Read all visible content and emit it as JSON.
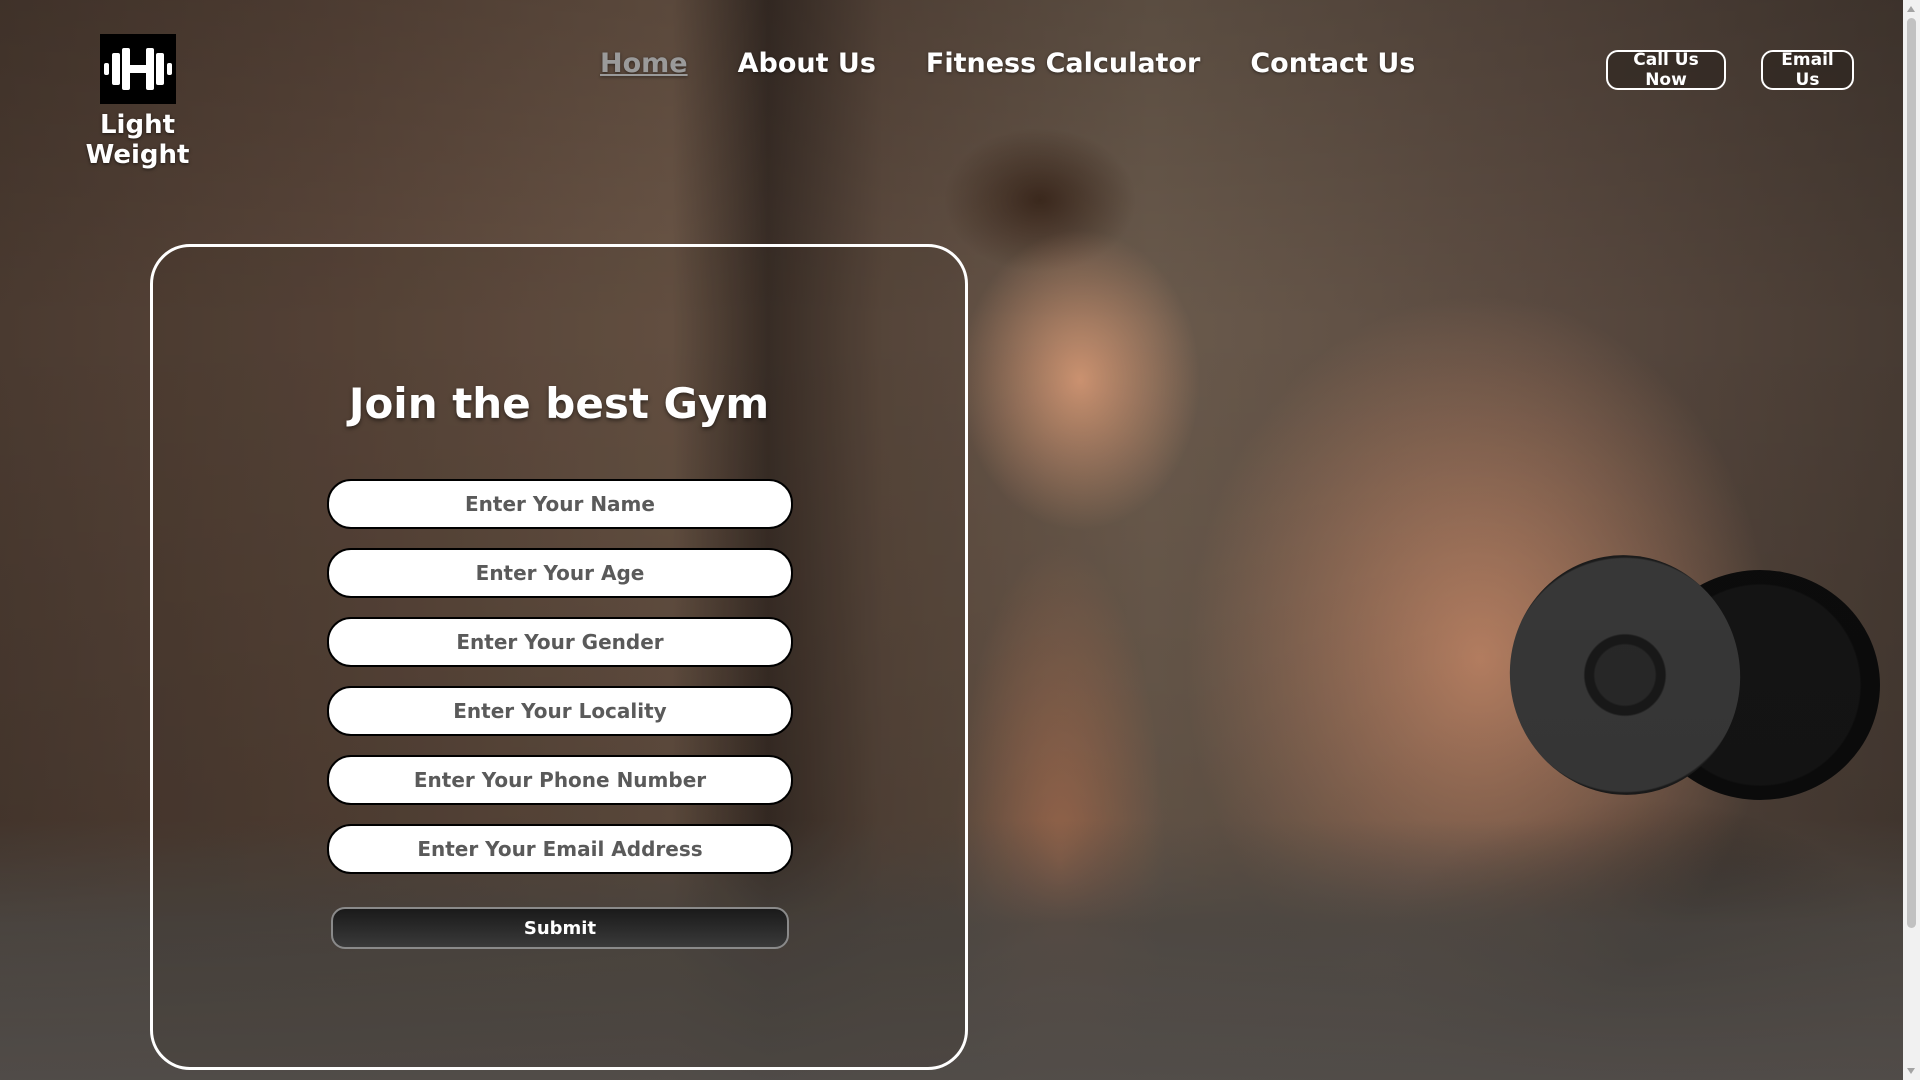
{
  "brand": {
    "name": "Light Weight",
    "logo_icon": "dumbbell-icon"
  },
  "nav": {
    "items": [
      {
        "label": "Home",
        "active": true
      },
      {
        "label": "About Us",
        "active": false
      },
      {
        "label": "Fitness Calculator",
        "active": false
      },
      {
        "label": "Contact Us",
        "active": false
      }
    ]
  },
  "actions": {
    "call_label": "Call Us Now",
    "email_label": "Email Us"
  },
  "form": {
    "title": "Join the best Gym",
    "fields": [
      {
        "placeholder": "Enter Your Name"
      },
      {
        "placeholder": "Enter Your Age"
      },
      {
        "placeholder": "Enter Your Gender"
      },
      {
        "placeholder": "Enter Your Locality"
      },
      {
        "placeholder": "Enter Your Phone Number"
      },
      {
        "placeholder": "Enter Your Email Address"
      }
    ],
    "submit_label": "Submit"
  },
  "colors": {
    "nav_active": "#9a9a9a",
    "text": "#ffffff",
    "field_bg": "#ffffff"
  }
}
